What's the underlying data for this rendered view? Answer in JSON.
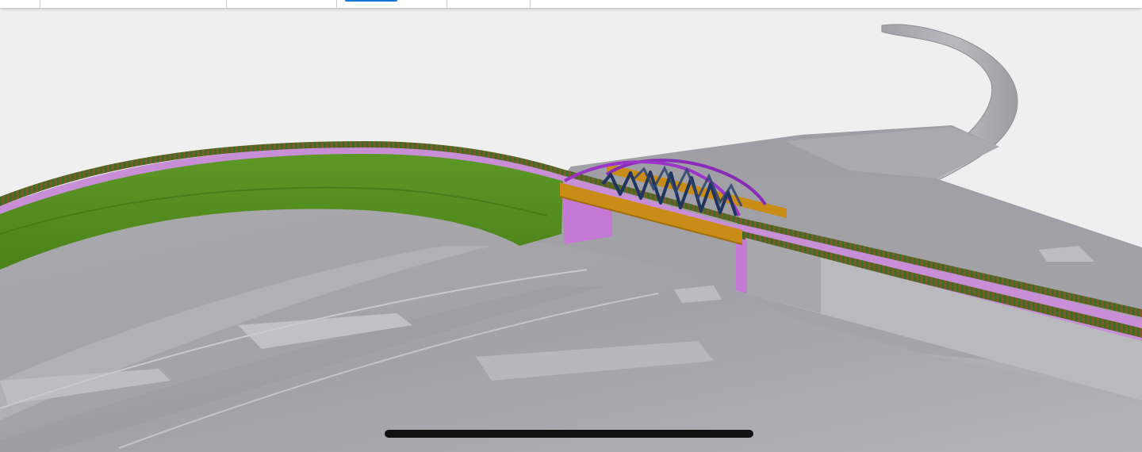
{
  "app": {
    "toolbar": {
      "tabs": [
        {
          "id": "tab-1",
          "active": false
        },
        {
          "id": "tab-2",
          "active": false
        },
        {
          "id": "tab-3",
          "active": false
        },
        {
          "id": "tab-4",
          "active": true
        },
        {
          "id": "tab-5",
          "active": false
        },
        {
          "id": "tab-6",
          "active": false
        }
      ],
      "accent_color": "#1677d6"
    }
  },
  "viewport": {
    "content": "3d-bridge-model",
    "colors": {
      "background": "#efefef",
      "terrain": "#a8a8ad",
      "embankment": "#5a9222",
      "deck": "#c88fd6",
      "arch": "#8a2ab8",
      "girder": "#c98c16",
      "bracing": "#1f3560",
      "abutment": "#c47ad4"
    }
  }
}
